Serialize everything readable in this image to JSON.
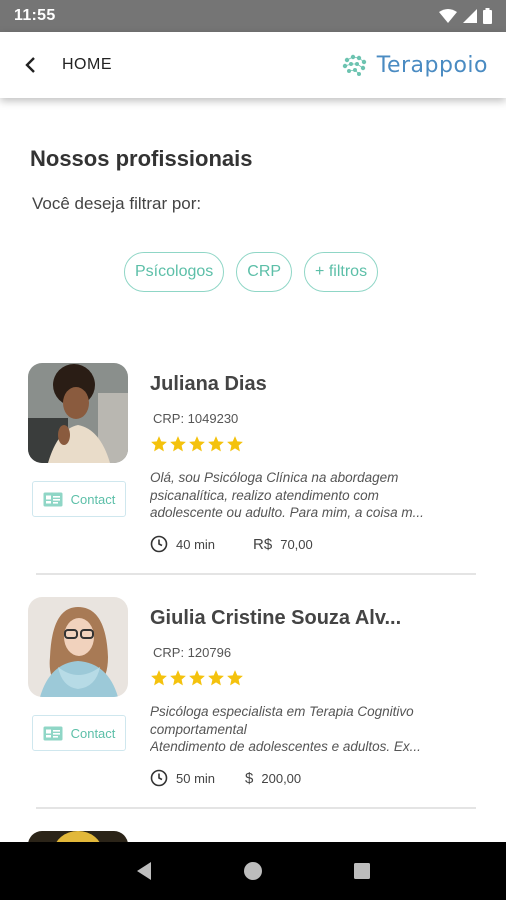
{
  "status_bar": {
    "time": "11:55"
  },
  "app_bar": {
    "title": "HOME",
    "brand": "Terappoio"
  },
  "section": {
    "title": "Nossos profissionais",
    "filter_label": "Você deseja filtrar por:"
  },
  "filters": [
    {
      "label": "Psícologos"
    },
    {
      "label": "CRP"
    },
    {
      "label": "+ filtros"
    }
  ],
  "professionals": [
    {
      "name": "Juliana Dias",
      "crp": "CRP: 1049230",
      "rating": 5,
      "description_lines": [
        "Olá, sou Psicóloga Clínica na abordagem",
        "psicanalítica, realizo atendimento com",
        "adolescente ou adulto. Para mim, a coisa m..."
      ],
      "duration": "40 min",
      "currency": "R$",
      "price": "70,00",
      "contact_label": "Contact"
    },
    {
      "name": "Giulia Cristine Souza Alv...",
      "crp": "CRP: 120796",
      "rating": 5,
      "description_lines": [
        "Psicóloga especialista em Terapia Cognitivo",
        "comportamental",
        "Atendimento de adolescentes e adultos. Ex..."
      ],
      "duration": "50 min",
      "currency": "$",
      "price": "200,00",
      "contact_label": "Contact"
    }
  ],
  "colors": {
    "accent": "#5cbfa8",
    "chip_border": "#8fd6c6",
    "star": "#f4c20d",
    "brand": "#4a8bc2"
  }
}
